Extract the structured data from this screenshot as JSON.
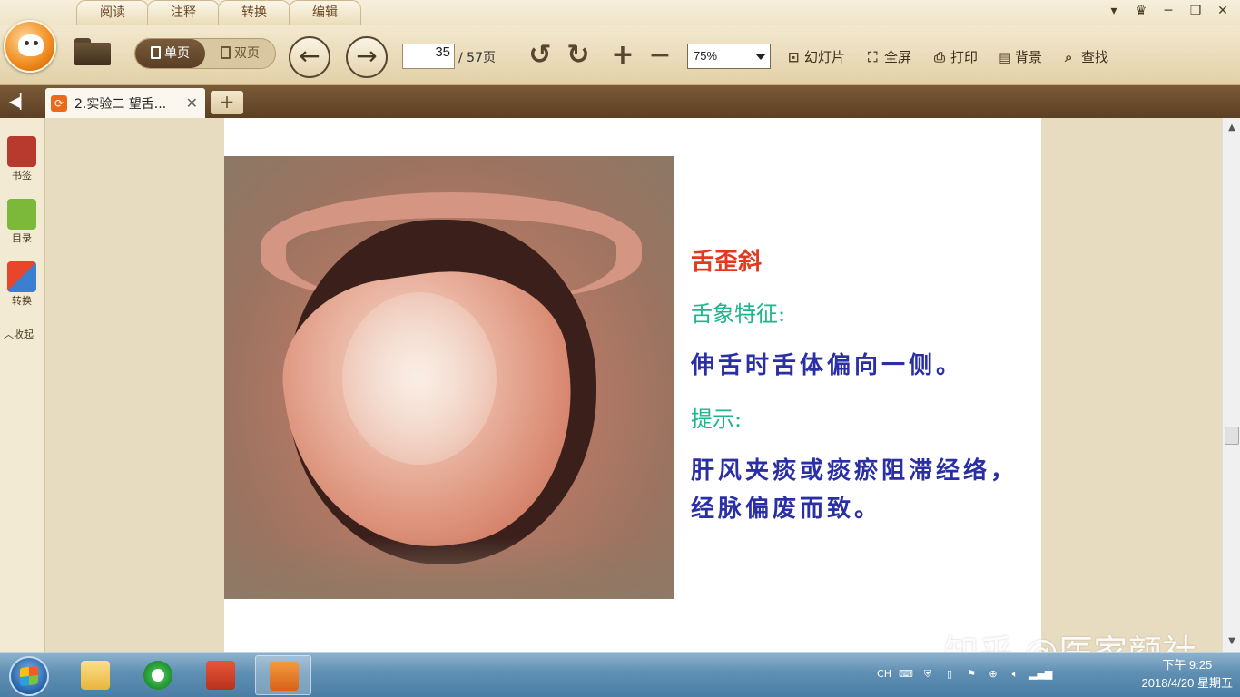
{
  "menu_tabs": [
    "阅读",
    "注释",
    "转换",
    "编辑"
  ],
  "view_toggle": {
    "single": "单页",
    "double": "双页"
  },
  "page_nav": {
    "current": "35",
    "total": "/ 57页"
  },
  "zoom": {
    "value": "75%"
  },
  "toolbar": {
    "slideshow": "幻灯片",
    "fullscreen": "全屏",
    "print": "打印",
    "background": "背景",
    "find": "查找"
  },
  "document_tab": {
    "title": "2.实验二 望舌..."
  },
  "sidebar": {
    "bookmark": "书签",
    "toc": "目录",
    "convert": "转换",
    "collapse": "收起"
  },
  "slide": {
    "title": "舌歪斜",
    "feature_label": "舌象特征:",
    "feature_text": "伸舌时舌体偏向一侧。",
    "hint_label": "提示:",
    "hint_text": "肝风夹痰或痰瘀阻滞经络，经脉偏废而致。"
  },
  "taskbar": {
    "lang": "CH",
    "time": "下午 9:25",
    "date": "2018/4/20 星期五"
  },
  "watermark": "知乎 @医家颜社",
  "colors": {
    "title_red": "#e33a1e",
    "label_green": "#1fb68a",
    "body_blue": "#2a2fa6"
  }
}
